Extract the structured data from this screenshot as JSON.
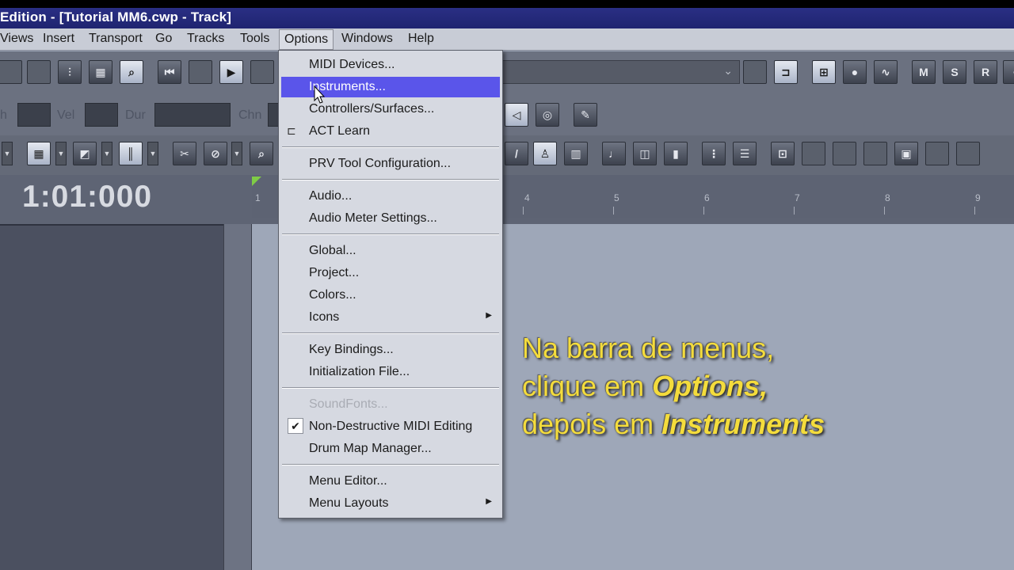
{
  "window": {
    "title": "Edition - [Tutorial MM6.cwp - Track]"
  },
  "menubar": {
    "items": [
      "Views",
      "Insert",
      "Transport",
      "Go",
      "Tracks",
      "Tools",
      "Options",
      "Windows",
      "Help"
    ],
    "active": "Options"
  },
  "toolbar2": {
    "labels": {
      "ch": "h",
      "vel": "Vel",
      "dur": "Dur",
      "chn": "Chn"
    }
  },
  "toolbar1": {
    "buttons": {
      "m": "M",
      "s": "S",
      "r": "R"
    }
  },
  "transport": {
    "time": "1:01:000"
  },
  "ruler": {
    "ticks": [
      "1",
      "4",
      "5",
      "6",
      "7",
      "8",
      "9"
    ]
  },
  "options_menu": {
    "items": [
      {
        "label": "MIDI Devices...",
        "state": "normal"
      },
      {
        "label": "Instruments...",
        "state": "highlighted"
      },
      {
        "label": "Controllers/Surfaces...",
        "state": "normal"
      },
      {
        "label": "ACT Learn",
        "state": "normal",
        "icon": "act-learn-icon"
      },
      {
        "label": "PRV Tool Configuration...",
        "state": "normal"
      },
      {
        "label": "Audio...",
        "state": "normal"
      },
      {
        "label": "Audio Meter Settings...",
        "state": "normal"
      },
      {
        "label": "Global...",
        "state": "normal"
      },
      {
        "label": "Project...",
        "state": "normal"
      },
      {
        "label": "Colors...",
        "state": "normal"
      },
      {
        "label": "Icons",
        "state": "submenu"
      },
      {
        "label": "Key Bindings...",
        "state": "normal"
      },
      {
        "label": "Initialization File...",
        "state": "normal"
      },
      {
        "label": "SoundFonts...",
        "state": "disabled"
      },
      {
        "label": "Non-Destructive MIDI Editing",
        "state": "checked"
      },
      {
        "label": "Drum Map Manager...",
        "state": "normal"
      },
      {
        "label": "Menu Editor...",
        "state": "normal"
      },
      {
        "label": "Menu Layouts",
        "state": "submenu"
      }
    ]
  },
  "caption": {
    "line1": "Na barra de menus,",
    "line2_pre": "clique em ",
    "line2_em": "Options,",
    "line3_pre": "depois em ",
    "line3_em": "Instruments"
  },
  "colors": {
    "highlight": "#5a55ea",
    "caption": "#f4dc3c",
    "title_bar": "#1f2470"
  }
}
